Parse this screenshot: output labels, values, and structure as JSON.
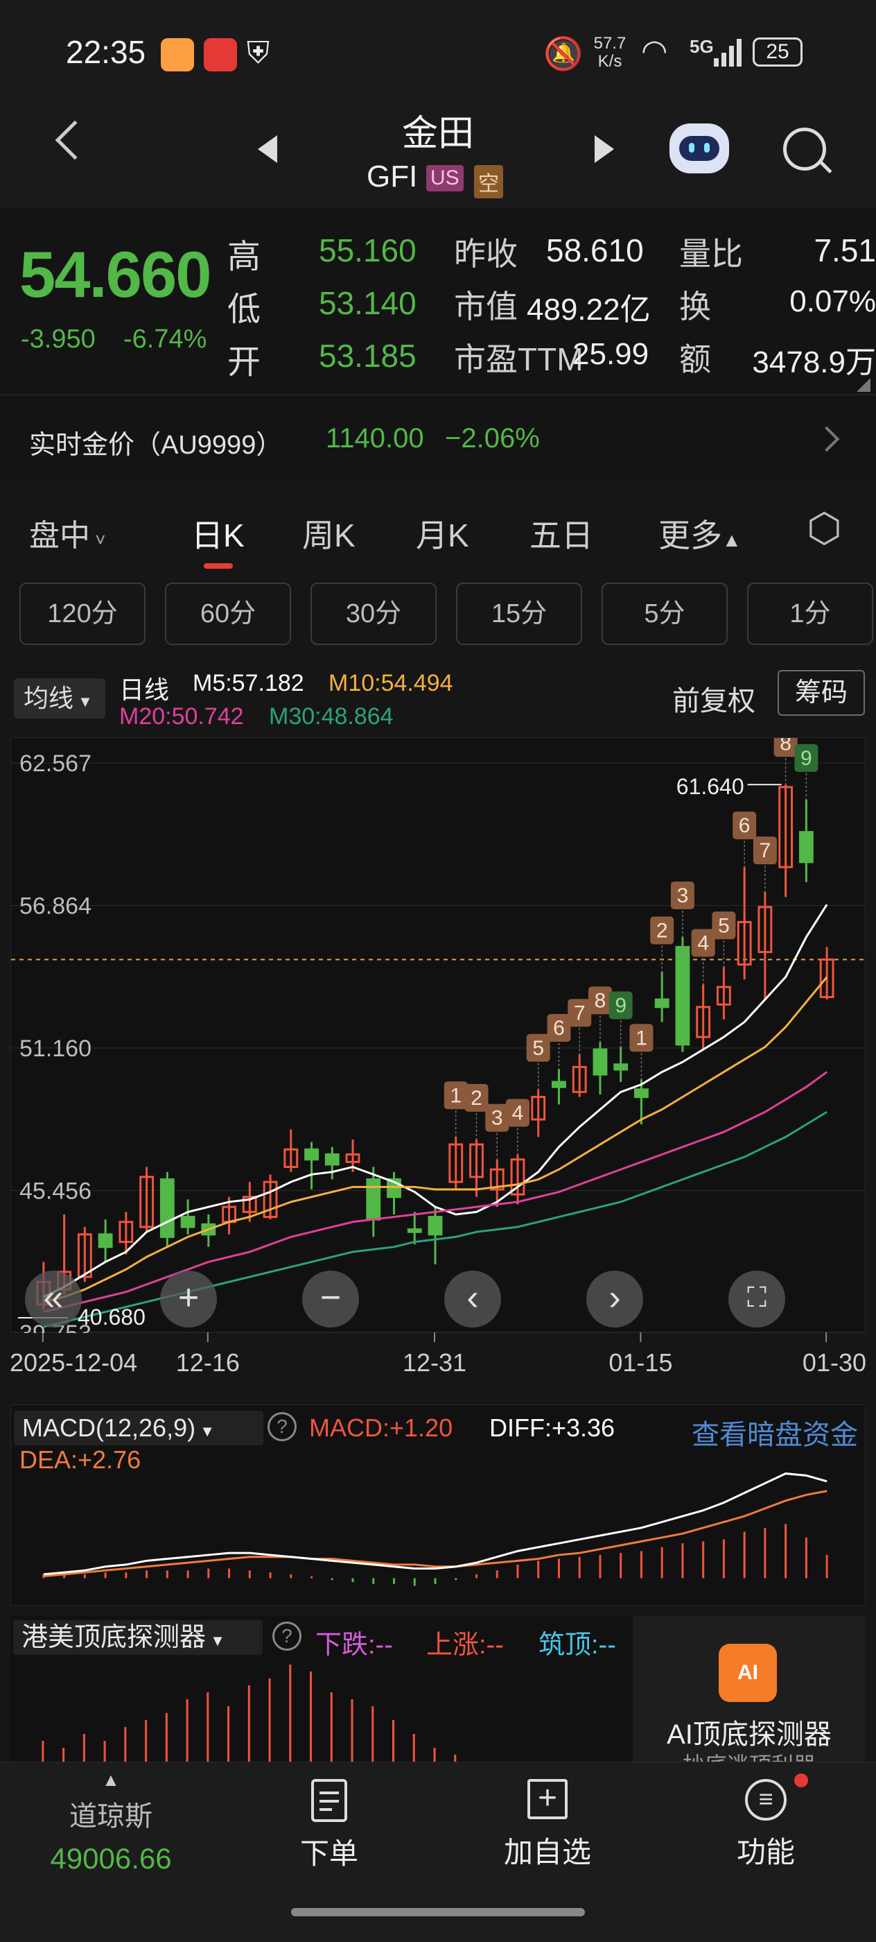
{
  "status_bar": {
    "time": "22:35",
    "net_speed_value": "57.7",
    "net_speed_unit": "K/s",
    "network": "5G",
    "battery": "25"
  },
  "header": {
    "stock_name": "金田",
    "ticker": "GFI",
    "badge_market": "US",
    "badge_short": "空"
  },
  "quote": {
    "price": "54.660",
    "change": "-3.950",
    "change_pct": "-6.74%",
    "high_label": "高",
    "high": "55.160",
    "low_label": "低",
    "low": "53.140",
    "open_label": "开",
    "open": "53.185",
    "prev_close_label": "昨收",
    "prev_close": "58.610",
    "market_cap_label": "市值",
    "market_cap": "489.22亿",
    "pe_label": "市盈TTM",
    "pe": "25.99",
    "volume_ratio_label": "量比",
    "volume_ratio": "7.51",
    "turnover_label": "换",
    "turnover": "0.07%",
    "amount_label": "额",
    "amount": "3478.9万"
  },
  "gold": {
    "label": "实时金价（AU9999）",
    "price": "1140.00",
    "change": "−2.06%"
  },
  "tabs": [
    "盘中",
    "日K",
    "周K",
    "月K",
    "五日",
    "更多"
  ],
  "intervals": [
    "120分",
    "60分",
    "30分",
    "15分",
    "5分",
    "1分"
  ],
  "ma_bar": {
    "select": "均线",
    "period": "日线",
    "m5": "M5:57.182",
    "m10": "M10:54.494",
    "m20": "M20:50.742",
    "m30": "M30:48.864",
    "adjust": "前复权",
    "chips": "筹码"
  },
  "colors": {
    "up": "#f0553d",
    "down": "#52b848",
    "m5": "#ffffff",
    "m10": "#f5b041",
    "m20": "#e0409c",
    "m30": "#2ba37a",
    "seq": "#8b5a3c"
  },
  "chart_data": {
    "type": "candlestick",
    "y_ticks": [
      "62.567",
      "56.864",
      "51.160",
      "45.456",
      "39.753"
    ],
    "ylim": [
      39.753,
      62.567
    ],
    "max_label": "61.640",
    "min_label": "40.680",
    "x_ticks": [
      "2025-12-04",
      "12-16",
      "12-31",
      "01-15",
      "01-30"
    ],
    "candles": [
      {
        "o": 40.9,
        "c": 41.8,
        "h": 42.6,
        "l": 40.7
      },
      {
        "o": 41.5,
        "c": 42.2,
        "h": 44.5,
        "l": 41.3
      },
      {
        "o": 42.0,
        "c": 43.7,
        "h": 44.0,
        "l": 41.8
      },
      {
        "o": 43.7,
        "c": 43.2,
        "h": 44.3,
        "l": 42.6
      },
      {
        "o": 43.4,
        "c": 44.2,
        "h": 44.6,
        "l": 42.9
      },
      {
        "o": 44.0,
        "c": 46.0,
        "h": 46.4,
        "l": 43.8
      },
      {
        "o": 45.9,
        "c": 43.6,
        "h": 46.2,
        "l": 43.2
      },
      {
        "o": 44.4,
        "c": 44.0,
        "h": 45.1,
        "l": 43.7
      },
      {
        "o": 44.1,
        "c": 43.7,
        "h": 44.5,
        "l": 43.2
      },
      {
        "o": 44.2,
        "c": 44.8,
        "h": 45.2,
        "l": 43.7
      },
      {
        "o": 44.6,
        "c": 45.2,
        "h": 45.8,
        "l": 44.2
      },
      {
        "o": 44.4,
        "c": 45.8,
        "h": 46.1,
        "l": 44.3
      },
      {
        "o": 46.4,
        "c": 47.1,
        "h": 47.9,
        "l": 46.2
      },
      {
        "o": 47.1,
        "c": 46.7,
        "h": 47.4,
        "l": 45.5
      },
      {
        "o": 46.9,
        "c": 46.5,
        "h": 47.2,
        "l": 45.9
      },
      {
        "o": 46.6,
        "c": 46.9,
        "h": 47.5,
        "l": 46.2
      },
      {
        "o": 45.9,
        "c": 44.3,
        "h": 46.4,
        "l": 43.6
      },
      {
        "o": 45.9,
        "c": 45.2,
        "h": 46.2,
        "l": 44.5
      },
      {
        "o": 43.9,
        "c": 43.8,
        "h": 44.6,
        "l": 43.3
      },
      {
        "o": 44.4,
        "c": 43.7,
        "h": 44.8,
        "l": 42.5
      },
      {
        "o": 45.8,
        "c": 47.3,
        "h": 47.6,
        "l": 45.5
      },
      {
        "o": 46.0,
        "c": 47.3,
        "h": 47.5,
        "l": 45.2
      },
      {
        "o": 45.5,
        "c": 46.3,
        "h": 46.7,
        "l": 44.8
      },
      {
        "o": 45.3,
        "c": 46.7,
        "h": 46.9,
        "l": 44.9
      },
      {
        "o": 48.3,
        "c": 49.2,
        "h": 49.5,
        "l": 47.6
      },
      {
        "o": 49.8,
        "c": 49.6,
        "h": 50.3,
        "l": 48.9
      },
      {
        "o": 49.4,
        "c": 50.4,
        "h": 50.9,
        "l": 49.2
      },
      {
        "o": 51.1,
        "c": 50.1,
        "h": 51.4,
        "l": 49.3
      },
      {
        "o": 50.5,
        "c": 50.3,
        "h": 51.2,
        "l": 49.8
      },
      {
        "o": 49.5,
        "c": 49.2,
        "h": 49.9,
        "l": 48.1
      },
      {
        "o": 53.1,
        "c": 52.8,
        "h": 54.2,
        "l": 52.2
      },
      {
        "o": 55.2,
        "c": 51.3,
        "h": 55.6,
        "l": 51.0
      },
      {
        "o": 51.6,
        "c": 52.8,
        "h": 53.7,
        "l": 51.1
      },
      {
        "o": 52.9,
        "c": 53.6,
        "h": 54.4,
        "l": 52.3
      },
      {
        "o": 54.5,
        "c": 56.2,
        "h": 58.4,
        "l": 53.9
      },
      {
        "o": 55.0,
        "c": 56.8,
        "h": 57.4,
        "l": 53.1
      },
      {
        "o": 58.4,
        "c": 61.6,
        "h": 61.7,
        "l": 57.2
      },
      {
        "o": 59.8,
        "c": 58.6,
        "h": 61.1,
        "l": 57.8
      },
      {
        "o": 53.2,
        "c": 54.7,
        "h": 55.2,
        "l": 53.1
      }
    ],
    "ma": {
      "m5": [
        41.2,
        41.6,
        42.1,
        42.6,
        43.0,
        43.8,
        44.2,
        44.6,
        44.8,
        45.0,
        45.1,
        45.4,
        45.8,
        46.1,
        46.2,
        46.4,
        46.1,
        45.8,
        45.4,
        44.8,
        44.5,
        44.6,
        45.0,
        45.6,
        46.2,
        47.2,
        48.0,
        48.7,
        49.4,
        49.7,
        50.2,
        50.6,
        51.1,
        51.6,
        52.2,
        53.1,
        54.0,
        55.6,
        56.9
      ],
      "m10": [
        41.0,
        41.2,
        41.5,
        41.9,
        42.3,
        42.8,
        43.2,
        43.6,
        43.9,
        44.2,
        44.4,
        44.7,
        45.0,
        45.2,
        45.4,
        45.6,
        45.6,
        45.6,
        45.6,
        45.5,
        45.5,
        45.5,
        45.6,
        45.7,
        45.9,
        46.3,
        46.8,
        47.3,
        47.8,
        48.3,
        48.7,
        49.2,
        49.7,
        50.2,
        50.7,
        51.2,
        52.0,
        53.0,
        54.0
      ],
      "m20": [
        40.6,
        40.8,
        41.0,
        41.2,
        41.4,
        41.7,
        42.0,
        42.3,
        42.6,
        42.8,
        43.0,
        43.3,
        43.6,
        43.8,
        44.0,
        44.2,
        44.3,
        44.4,
        44.5,
        44.6,
        44.7,
        44.8,
        44.9,
        45.0,
        45.2,
        45.4,
        45.7,
        46.0,
        46.3,
        46.6,
        46.9,
        47.2,
        47.5,
        47.8,
        48.2,
        48.6,
        49.1,
        49.6,
        50.2
      ],
      "m30": [
        40.0,
        40.2,
        40.4,
        40.6,
        40.8,
        41.0,
        41.2,
        41.4,
        41.6,
        41.8,
        42.0,
        42.2,
        42.4,
        42.6,
        42.8,
        43.0,
        43.1,
        43.2,
        43.4,
        43.5,
        43.6,
        43.8,
        43.9,
        44.0,
        44.2,
        44.4,
        44.6,
        44.8,
        45.0,
        45.3,
        45.6,
        45.9,
        46.2,
        46.5,
        46.8,
        47.2,
        47.6,
        48.1,
        48.6
      ]
    },
    "sequence_marks": [
      {
        "i": 20,
        "n": "1"
      },
      {
        "i": 21,
        "n": "2"
      },
      {
        "i": 22,
        "n": "3"
      },
      {
        "i": 23,
        "n": "4"
      },
      {
        "i": 24,
        "n": "5"
      },
      {
        "i": 25,
        "n": "6"
      },
      {
        "i": 26,
        "n": "7"
      },
      {
        "i": 27,
        "n": "8"
      },
      {
        "i": 28,
        "n": "9"
      },
      {
        "i": 29,
        "n": "1"
      },
      {
        "i": 30,
        "n": "2"
      },
      {
        "i": 31,
        "n": "3"
      },
      {
        "i": 32,
        "n": "4"
      },
      {
        "i": 33,
        "n": "5"
      },
      {
        "i": 34,
        "n": "6"
      },
      {
        "i": 35,
        "n": "7"
      },
      {
        "i": 36,
        "n": "8"
      },
      {
        "i": 37,
        "n": "9"
      }
    ]
  },
  "macd": {
    "title": "MACD(12,26,9)",
    "macd": "MACD:+1.20",
    "diff": "DIFF:+3.36",
    "dea": "DEA:+2.76",
    "link": "查看暗盘资金",
    "diff_series": [
      0.2,
      0.3,
      0.4,
      0.6,
      0.7,
      0.9,
      1.0,
      1.1,
      1.2,
      1.3,
      1.3,
      1.2,
      1.1,
      1.0,
      0.9,
      0.8,
      0.7,
      0.6,
      0.5,
      0.5,
      0.6,
      0.8,
      1.1,
      1.4,
      1.6,
      1.8,
      2.0,
      2.2,
      2.4,
      2.6,
      2.9,
      3.2,
      3.5,
      3.9,
      4.4,
      4.9,
      5.4,
      5.3,
      5.0
    ],
    "dea_series": [
      0.1,
      0.2,
      0.3,
      0.4,
      0.5,
      0.6,
      0.7,
      0.8,
      0.9,
      1.0,
      1.1,
      1.1,
      1.1,
      1.0,
      1.0,
      0.9,
      0.8,
      0.7,
      0.7,
      0.6,
      0.6,
      0.7,
      0.8,
      0.9,
      1.0,
      1.2,
      1.3,
      1.5,
      1.7,
      1.9,
      2.1,
      2.3,
      2.6,
      2.9,
      3.2,
      3.6,
      4.0,
      4.3,
      4.5
    ],
    "hist": [
      0.2,
      0.2,
      0.2,
      0.3,
      0.3,
      0.4,
      0.4,
      0.4,
      0.5,
      0.5,
      0.4,
      0.3,
      0.2,
      0.1,
      -0.1,
      -0.2,
      -0.3,
      -0.3,
      -0.4,
      -0.3,
      -0.1,
      0.2,
      0.4,
      0.7,
      0.9,
      1.0,
      1.1,
      1.2,
      1.3,
      1.4,
      1.6,
      1.8,
      1.9,
      2.0,
      2.4,
      2.6,
      2.8,
      2.1,
      1.2
    ]
  },
  "detector": {
    "title": "港美顶底探测器",
    "down": "下跌:--",
    "up": "上涨:--",
    "top": "筑顶:--",
    "ai_title": "AI顶底探测器",
    "ai_sub": "抄底逃顶利器",
    "bars": [
      0.15,
      0.1,
      0.2,
      0.15,
      0.25,
      0.3,
      0.35,
      0.45,
      0.5,
      0.4,
      0.55,
      0.6,
      0.7,
      0.65,
      0.5,
      0.45,
      0.4,
      0.3,
      0.2,
      0.1,
      0.05,
      0.0,
      0.0,
      0.0,
      0.0,
      0.0,
      0.0,
      0.0,
      0.0,
      0.0,
      0.0,
      0.0,
      0.0,
      0.0,
      0.0,
      0.0,
      0.1,
      0.2,
      0.3
    ]
  },
  "bottom": {
    "index_name": "道琼斯",
    "index_value": "49006.66",
    "order": "下单",
    "watch": "加自选",
    "func": "功能"
  }
}
